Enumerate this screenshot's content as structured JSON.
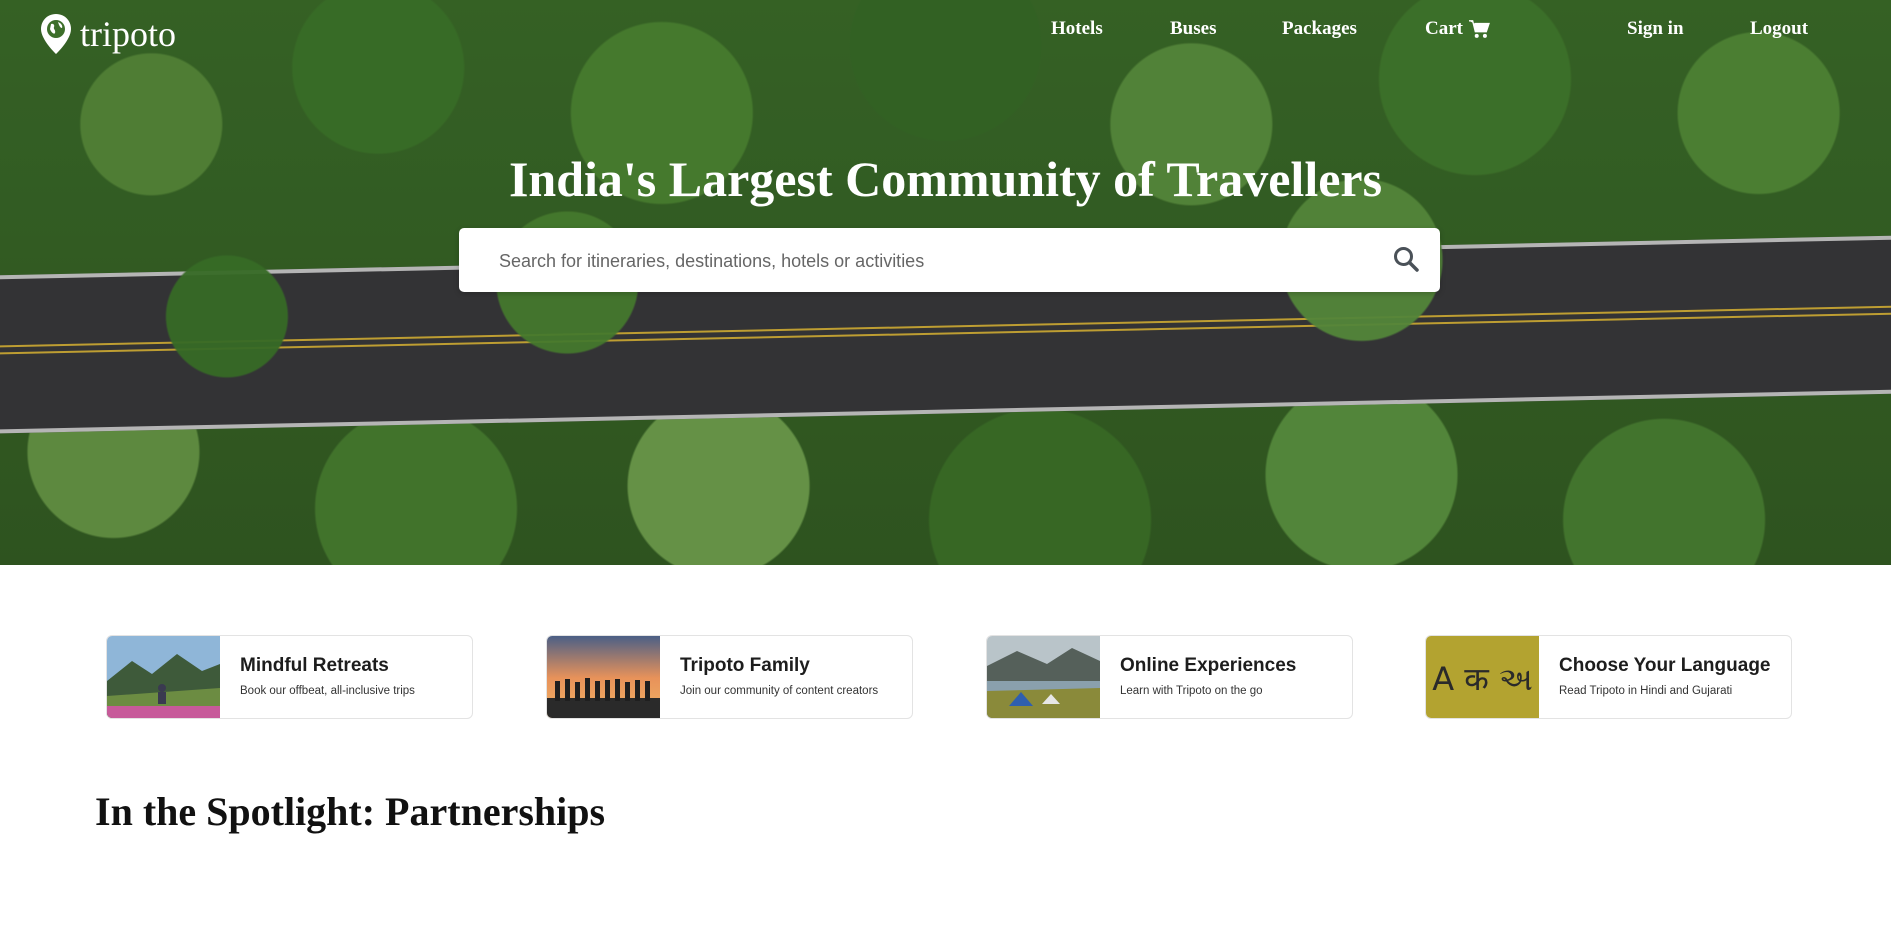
{
  "brand": {
    "name": "tripoto"
  },
  "nav": {
    "hotels": "Hotels",
    "buses": "Buses",
    "packages": "Packages",
    "cart": "Cart",
    "sign_in": "Sign in",
    "logout": "Logout"
  },
  "hero": {
    "headline": "India's Largest Community of Travellers",
    "search_placeholder": "Search for itineraries, destinations, hotels or activities"
  },
  "cards": [
    {
      "title": "Mindful Retreats",
      "subtitle": "Book our offbeat, all-inclusive trips"
    },
    {
      "title": "Tripoto Family",
      "subtitle": "Join our community of content creators"
    },
    {
      "title": "Online Experiences",
      "subtitle": "Learn with Tripoto on the go"
    },
    {
      "title": "Choose Your Language",
      "subtitle": "Read Tripoto in Hindi and Gujarati",
      "thumb_text": "A क અ"
    }
  ],
  "spotlight": {
    "title": "In the Spotlight: Partnerships"
  },
  "colors": {
    "language_tile": "#b3a330",
    "hero_green": "#3d6f2a"
  }
}
